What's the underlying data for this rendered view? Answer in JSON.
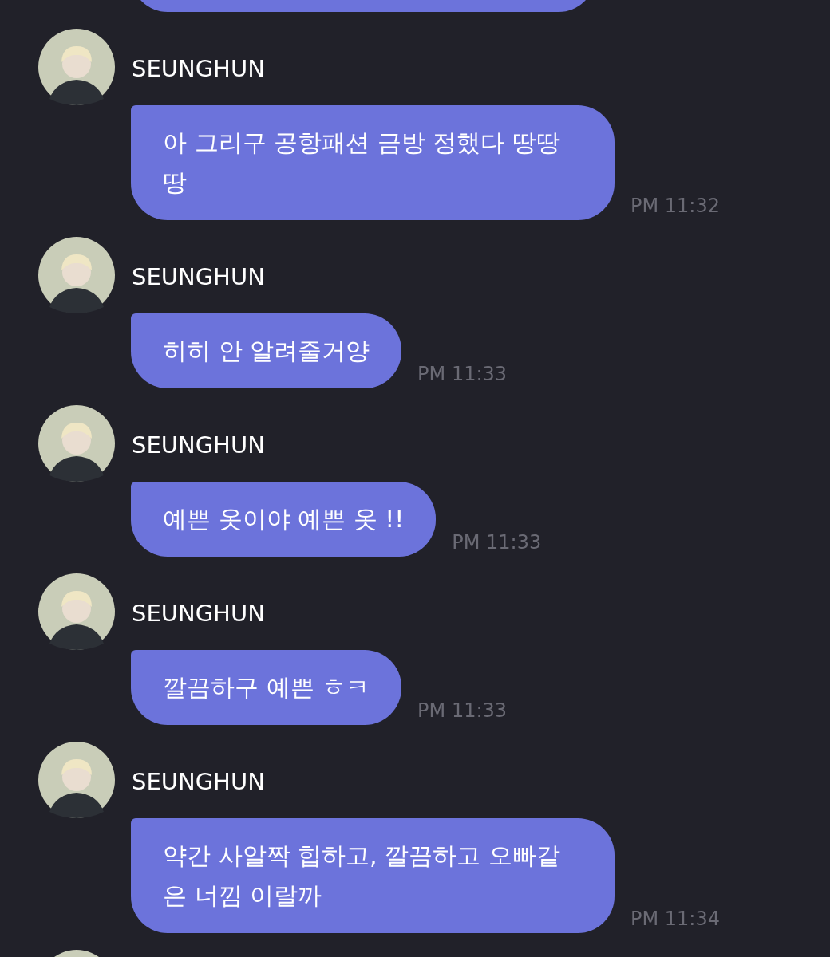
{
  "messages": [
    {
      "kind": "cut-top"
    },
    {
      "kind": "message",
      "sender": "SEUNGHUN",
      "text": "아 그리구 공항패션 금방 정했다 땅땅 땅",
      "time": "PM 11:32"
    },
    {
      "kind": "message",
      "sender": "SEUNGHUN",
      "text": "히히 안 알려줄거양",
      "time": "PM 11:33"
    },
    {
      "kind": "message",
      "sender": "SEUNGHUN",
      "text": "예쁜 옷이야 예쁜 옷 !!",
      "time": "PM 11:33"
    },
    {
      "kind": "message",
      "sender": "SEUNGHUN",
      "text": "깔끔하구 예쁜 ㅎㅋ",
      "time": "PM 11:33"
    },
    {
      "kind": "message",
      "sender": "SEUNGHUN",
      "text": "약간 사알짝 힙하고, 깔끔하고 오빠같은 너낌 이랄까",
      "time": "PM 11:34"
    },
    {
      "kind": "cut-bottom"
    }
  ]
}
